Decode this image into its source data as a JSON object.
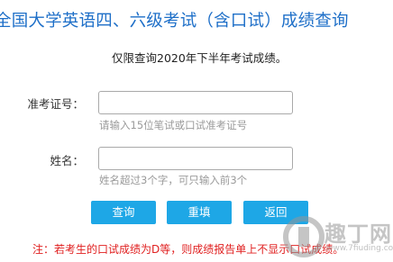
{
  "header": {
    "title": "全国大学英语四、六级考试（含口试）成绩查询"
  },
  "notice": "仅限查询2020年下半年考试成绩。",
  "form": {
    "ticket_label": "准考证号：",
    "ticket_value": "",
    "ticket_hint": "请输入15位笔试或口试准考证号",
    "name_label": "姓名：",
    "name_value": "",
    "name_hint": "姓名超过3个字，可只输入前3个"
  },
  "buttons": {
    "query": "查询",
    "reset": "重填",
    "back": "返回"
  },
  "footer": {
    "note": "注：若考生的口试成绩为D等，则成绩报告单上不显示口试成绩。"
  },
  "watermark": {
    "text": "趣丁网",
    "url": "www.7fiuding.com"
  },
  "colors": {
    "title": "#1e6fc8",
    "button": "#1ea7e6",
    "note": "#e02020",
    "hint": "#9a9a9a"
  }
}
